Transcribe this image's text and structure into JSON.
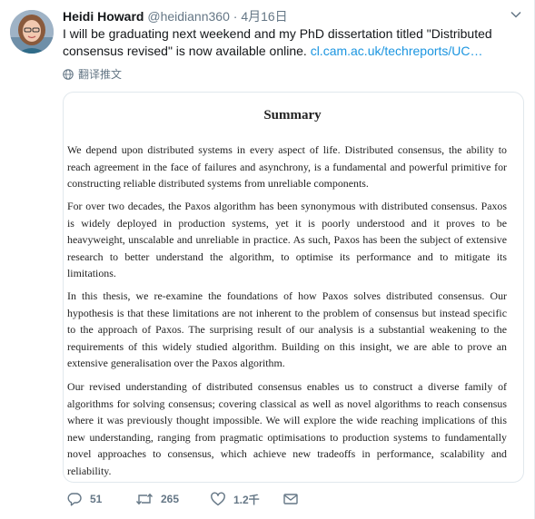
{
  "tweet": {
    "author_name": "Heidi Howard",
    "handle": "@heidiann360",
    "separator": "·",
    "date": "4月16日",
    "text": "I will be graduating next weekend and my PhD dissertation titled \"Distributed consensus revised\" is now available online. ",
    "link": "cl.cam.ac.uk/techreports/UC…",
    "translate_label": "翻译推文"
  },
  "document": {
    "title": "Summary",
    "paragraphs": [
      "We depend upon distributed systems in every aspect of life. Distributed consensus, the ability to reach agreement in the face of failures and asynchrony, is a fundamental and powerful primitive for constructing reliable distributed systems from unreliable components.",
      "For over two decades, the Paxos algorithm has been synonymous with distributed consensus. Paxos is widely deployed in production systems, yet it is poorly understood and it proves to be heavyweight, unscalable and unreliable in practice. As such, Paxos has been the subject of extensive research to better understand the algorithm, to optimise its performance and to mitigate its limitations.",
      "In this thesis, we re-examine the foundations of how Paxos solves distributed consensus. Our hypothesis is that these limitations are not inherent to the problem of consensus but instead specific to the approach of Paxos. The surprising result of our analysis is a substantial weakening to the requirements of this widely studied algorithm. Building on this insight, we are able to prove an extensive generalisation over the Paxos algorithm.",
      "Our revised understanding of distributed consensus enables us to construct a diverse family of algorithms for solving consensus; covering classical as well as novel algorithms to reach consensus where it was previously thought impossible. We will explore the wide reaching implications of this new understanding, ranging from pragmatic optimisations to production systems to fundamentally novel approaches to consensus, which achieve new tradeoffs in performance, scalability and reliability."
    ]
  },
  "actions": {
    "reply_count": "51",
    "retweet_count": "265",
    "like_count": "1.2千"
  },
  "icons": {
    "reply": "reply-icon",
    "retweet": "retweet-icon",
    "like": "heart-icon",
    "message": "envelope-icon",
    "caret": "chevron-down-icon",
    "translate": "globe-icon"
  },
  "colors": {
    "link": "#1b95e0",
    "secondary_text": "#657786",
    "border": "#e1e8ed"
  }
}
